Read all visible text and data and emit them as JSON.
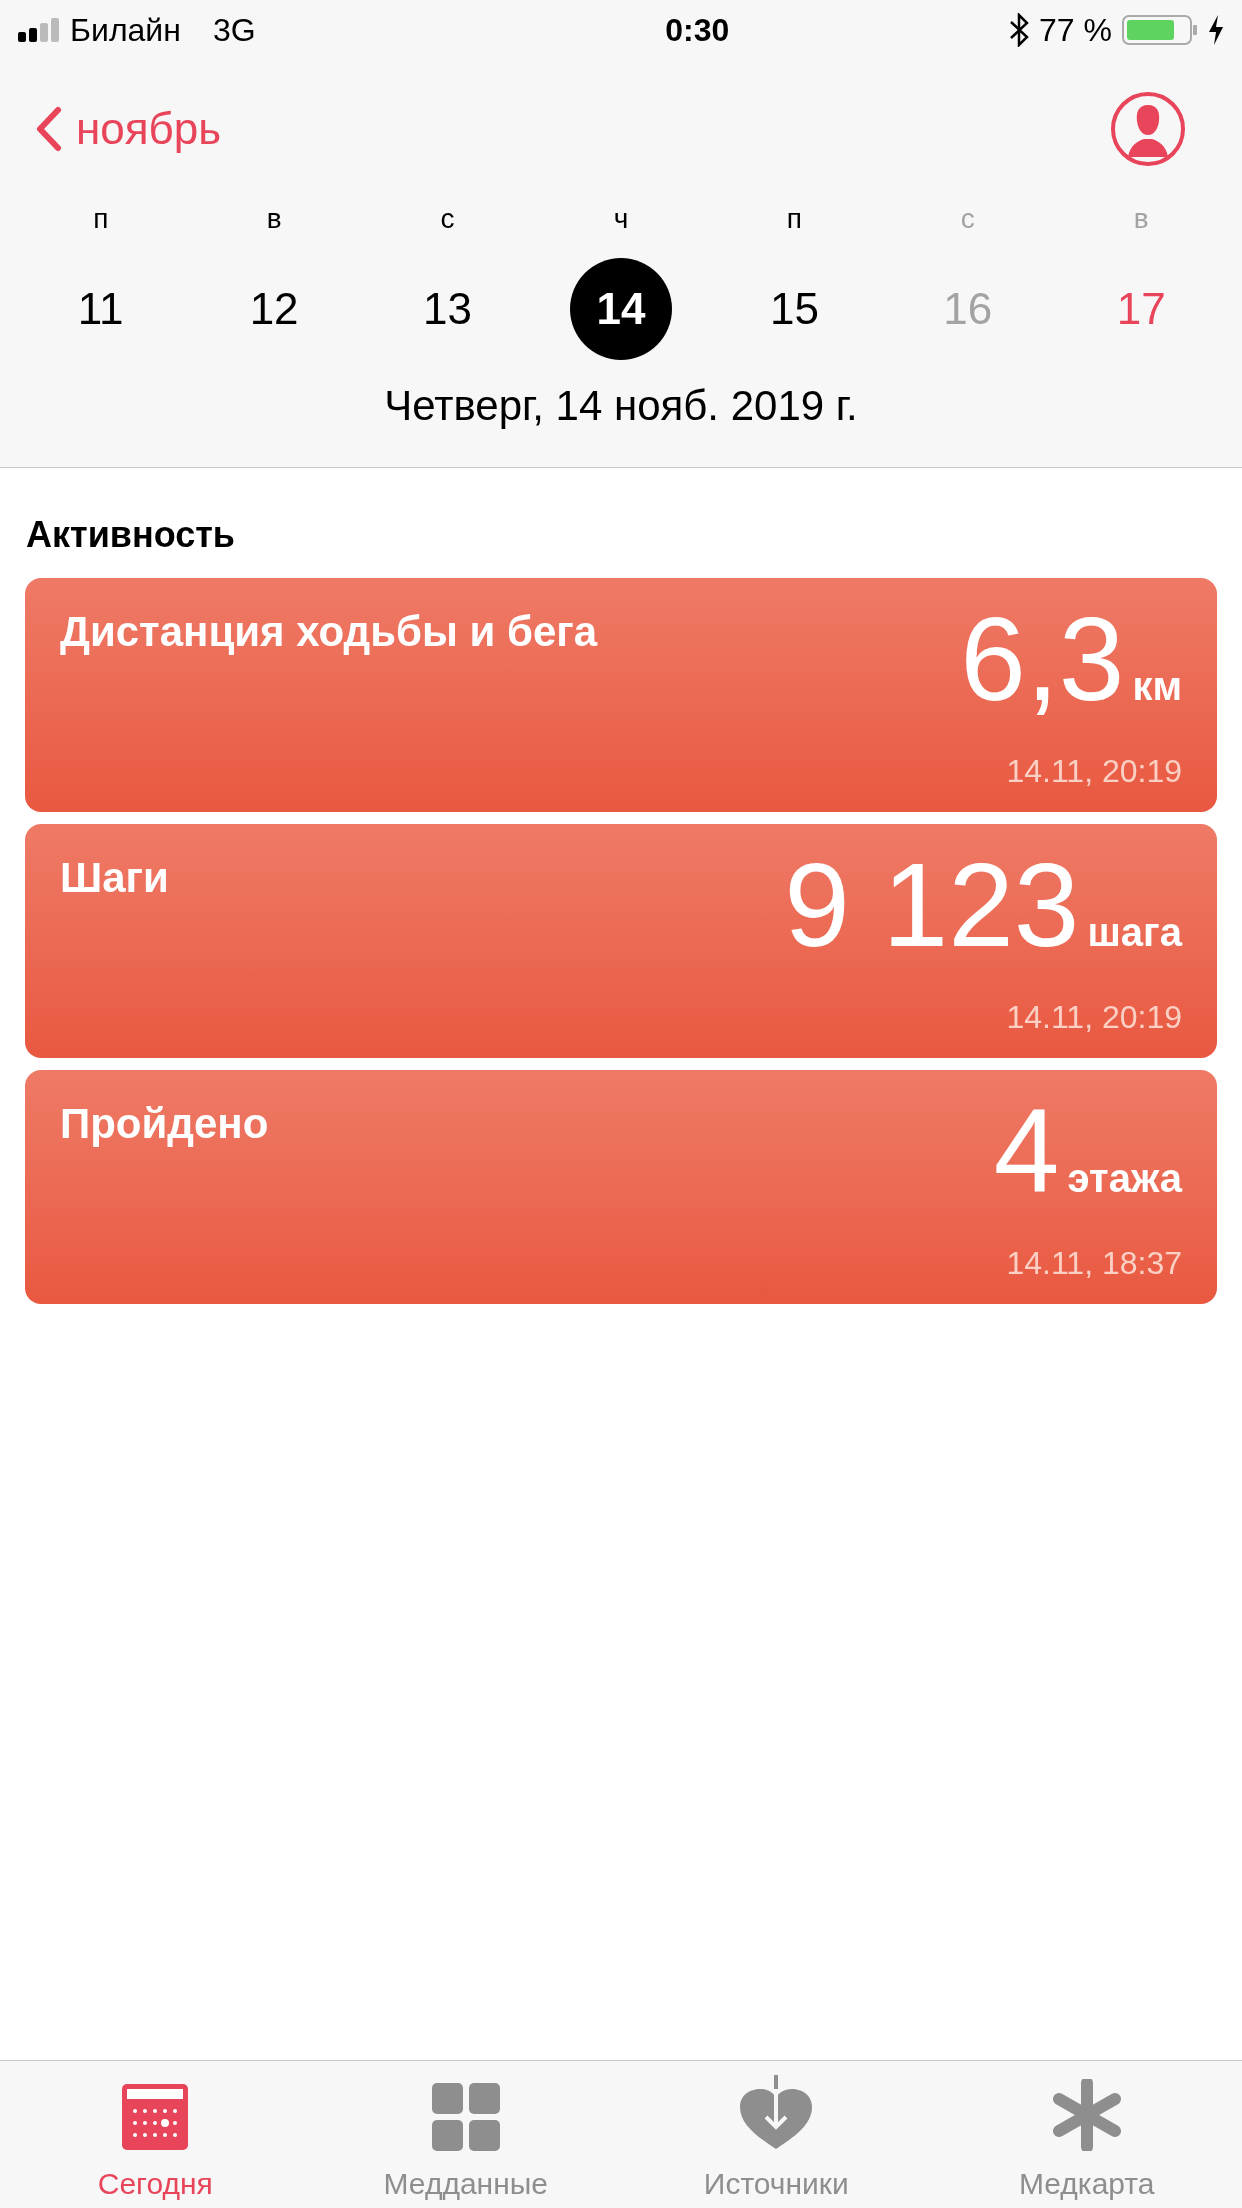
{
  "status_bar": {
    "carrier": "Билайн",
    "network": "3G",
    "time": "0:30",
    "battery": "77 %"
  },
  "nav": {
    "back_label": "ноябрь"
  },
  "week": [
    {
      "weekday": "п",
      "day": "11",
      "weekday_muted": false,
      "color": "#000000",
      "selected": false
    },
    {
      "weekday": "в",
      "day": "12",
      "weekday_muted": false,
      "color": "#000000",
      "selected": false
    },
    {
      "weekday": "с",
      "day": "13",
      "weekday_muted": false,
      "color": "#000000",
      "selected": false
    },
    {
      "weekday": "ч",
      "day": "14",
      "weekday_muted": false,
      "color": "#000000",
      "selected": true
    },
    {
      "weekday": "п",
      "day": "15",
      "weekday_muted": false,
      "color": "#000000",
      "selected": false
    },
    {
      "weekday": "с",
      "day": "16",
      "weekday_muted": true,
      "color": "#a3a3a3",
      "selected": false
    },
    {
      "weekday": "в",
      "day": "17",
      "weekday_muted": true,
      "color": "#e8445a",
      "selected": false
    }
  ],
  "date_label": "Четверг, 14 нояб. 2019 г.",
  "section": {
    "title": "Активность",
    "cards": [
      {
        "title": "Дистанция ходьбы и бега",
        "value": "6,3",
        "unit": "км",
        "time": "14.11, 20:19"
      },
      {
        "title": "Шаги",
        "value": "9 123",
        "unit": "шага",
        "time": "14.11, 20:19"
      },
      {
        "title": "Пройдено",
        "value": "4",
        "unit": "этажа",
        "time": "14.11, 18:37"
      }
    ]
  },
  "tab_bar": [
    {
      "label": "Сегодня",
      "kind": "today",
      "selected": true
    },
    {
      "label": "Медданные",
      "kind": "data",
      "selected": false
    },
    {
      "label": "Источники",
      "kind": "sources",
      "selected": false
    },
    {
      "label": "Медкарта",
      "kind": "card",
      "selected": false
    }
  ]
}
